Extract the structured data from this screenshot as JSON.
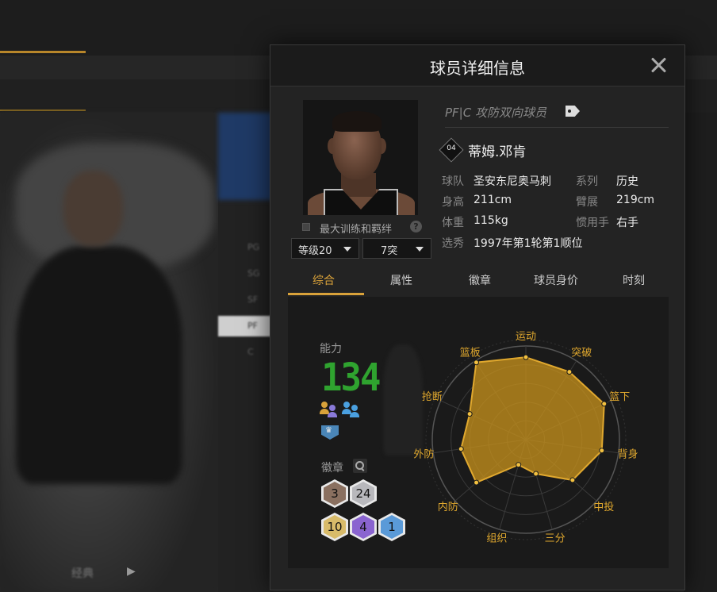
{
  "background": {
    "top_tabs": [
      "",
      "",
      "",
      ""
    ],
    "sub_tabs": [
      "",
      ""
    ],
    "footer_label": "经典",
    "positions": [
      "PG",
      "SG",
      "SF",
      "PF",
      "C"
    ]
  },
  "modal": {
    "title": "球员详细信息",
    "training_label": "最大训练和羁绊",
    "level_select": "等级20",
    "break_select": "7突",
    "player_type": "PF|C 攻防双向球员",
    "jersey_number": "04",
    "name": "蒂姆.邓肯",
    "info": [
      {
        "label": "球队",
        "value": "圣安东尼奥马刺"
      },
      {
        "label": "系列",
        "value": "历史"
      },
      {
        "label": "身高",
        "value": "211cm"
      },
      {
        "label": "臂展",
        "value": "219cm"
      },
      {
        "label": "体重",
        "value": "115kg"
      },
      {
        "label": "惯用手",
        "value": "右手"
      },
      {
        "label": "选秀",
        "value": "1997年第1轮第1顺位"
      }
    ],
    "tabs": [
      "综合",
      "属性",
      "徽章",
      "球员身价",
      "时刻"
    ],
    "active_tab": 0,
    "ability_label": "能力",
    "ability_value": "134",
    "badges_label": "徽章",
    "badges": [
      {
        "count": "3",
        "tier": "bronze",
        "color": "#8a7060"
      },
      {
        "count": "24",
        "tier": "silver",
        "color": "#b8b8bc"
      },
      {
        "count": "10",
        "tier": "gold",
        "color": "#d8bb6a"
      },
      {
        "count": "4",
        "tier": "purple",
        "color": "#8a64d0"
      },
      {
        "count": "1",
        "tier": "blue",
        "color": "#5a9ad8"
      }
    ]
  },
  "chart_data": {
    "type": "radar",
    "categories": [
      "运动",
      "突破",
      "篮下",
      "背身",
      "中投",
      "三分",
      "组织",
      "内防",
      "外防",
      "抢断",
      "篮板"
    ],
    "values": [
      0.88,
      0.86,
      0.92,
      0.82,
      0.66,
      0.38,
      0.28,
      0.7,
      0.7,
      0.66,
      0.98
    ],
    "fill_color": "#c48f1c",
    "stroke_color": "#e0a82e"
  },
  "colors": {
    "accent": "#d9a23a",
    "ability": "#2fa32f"
  }
}
